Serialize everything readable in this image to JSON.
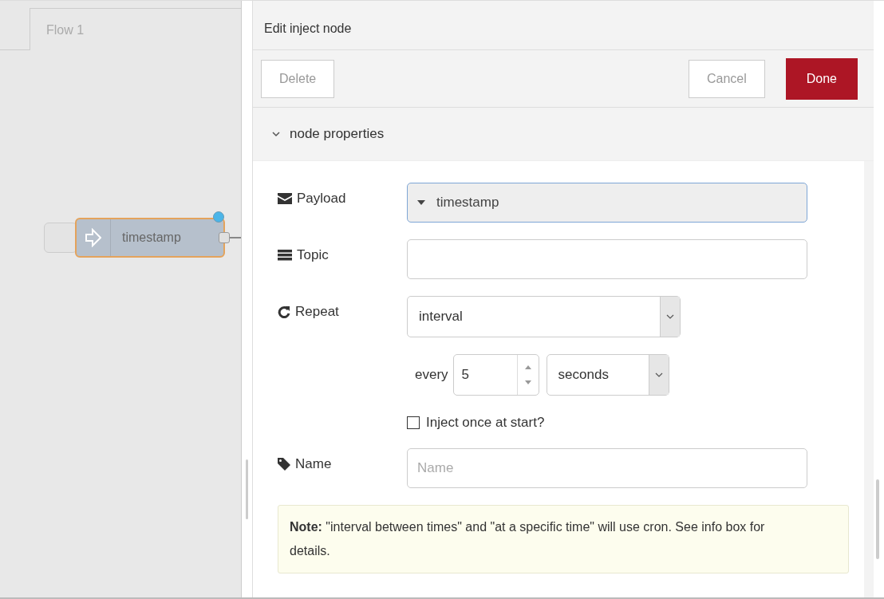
{
  "canvas": {
    "tabs": [
      {
        "label": "Flow 1",
        "selected": true
      }
    ],
    "nodes": [
      {
        "label": "timestamp",
        "selected": true,
        "changed": true
      }
    ]
  },
  "editor": {
    "title": "Edit inject node",
    "buttons": [
      {
        "label": "Delete",
        "kind": "plain"
      },
      {
        "label": "Cancel",
        "kind": "plain"
      },
      {
        "label": "Done",
        "kind": "primary"
      }
    ],
    "section": {
      "label": "node properties",
      "expanded": true
    },
    "payload": {
      "label": "Payload",
      "value": "timestamp"
    },
    "topic": {
      "label": "Topic"
    },
    "repeat": {
      "label": "Repeat",
      "value": "interval"
    },
    "interval": {
      "label": "every",
      "value": "5",
      "unit": "seconds"
    },
    "once": {
      "label": "Inject once at start?",
      "checked": false
    },
    "name": {
      "label": "Name",
      "placeholder": "Name"
    },
    "note": "**Note:** \"interval between times\" and \"at a specific time\" will use cron. See info box for details."
  }
}
